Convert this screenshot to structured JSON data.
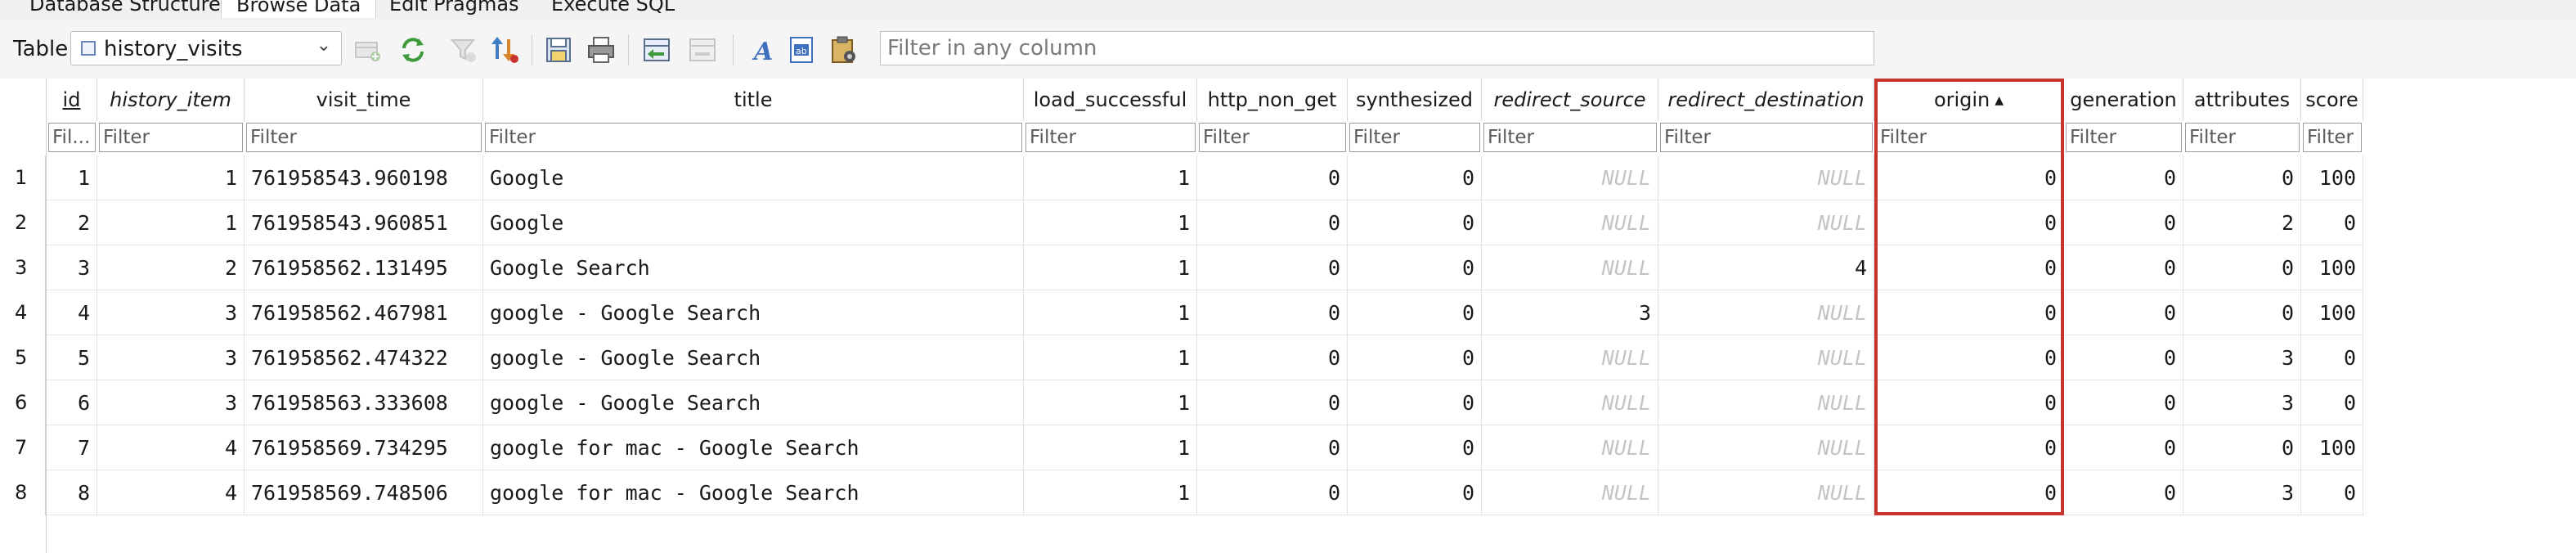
{
  "tabs": [
    {
      "label": "Database Structure",
      "active": false
    },
    {
      "label": "Browse Data",
      "active": true
    },
    {
      "label": "Edit Pragmas",
      "active": false
    },
    {
      "label": "Execute SQL",
      "active": false
    }
  ],
  "toolbar": {
    "table_label": "Table:",
    "table_name": "history_visits",
    "filter_placeholder": "Filter in any column"
  },
  "columns": [
    {
      "key": "id",
      "label": "id",
      "italic": false,
      "underline": true,
      "sorted": false
    },
    {
      "key": "history_item",
      "label": "history_item",
      "italic": true,
      "underline": false,
      "sorted": false
    },
    {
      "key": "visit_time",
      "label": "visit_time",
      "italic": false,
      "underline": false,
      "sorted": false
    },
    {
      "key": "title",
      "label": "title",
      "italic": false,
      "underline": false,
      "sorted": false
    },
    {
      "key": "load_successful",
      "label": "load_successful",
      "italic": false,
      "underline": false,
      "sorted": false
    },
    {
      "key": "http_non_get",
      "label": "http_non_get",
      "italic": false,
      "underline": false,
      "sorted": false
    },
    {
      "key": "synthesized",
      "label": "synthesized",
      "italic": false,
      "underline": false,
      "sorted": false
    },
    {
      "key": "redirect_source",
      "label": "redirect_source",
      "italic": true,
      "underline": false,
      "sorted": false
    },
    {
      "key": "redirect_destination",
      "label": "redirect_destination",
      "italic": true,
      "underline": false,
      "sorted": false
    },
    {
      "key": "origin",
      "label": "origin",
      "italic": false,
      "underline": false,
      "sorted": true,
      "sort_indicator": "▲"
    },
    {
      "key": "generation",
      "label": "generation",
      "italic": false,
      "underline": false,
      "sorted": false
    },
    {
      "key": "attributes",
      "label": "attributes",
      "italic": false,
      "underline": false,
      "sorted": false
    },
    {
      "key": "score",
      "label": "score",
      "italic": false,
      "underline": false,
      "sorted": false
    }
  ],
  "filter_placeholders": [
    "Fil...",
    "Filter",
    "Filter",
    "Filter",
    "Filter",
    "Filter",
    "Filter",
    "Filter",
    "Filter",
    "Filter",
    "Filter",
    "Filter",
    "Filter"
  ],
  "rows": [
    {
      "rownum": "1",
      "cells": [
        "1",
        "1",
        "761958543.960198",
        "Google",
        "1",
        "0",
        "0",
        "NULL",
        "NULL",
        "0",
        "0",
        "0",
        "100"
      ]
    },
    {
      "rownum": "2",
      "cells": [
        "2",
        "1",
        "761958543.960851",
        "Google",
        "1",
        "0",
        "0",
        "NULL",
        "NULL",
        "0",
        "0",
        "2",
        "0"
      ]
    },
    {
      "rownum": "3",
      "cells": [
        "3",
        "2",
        "761958562.131495",
        "Google Search",
        "1",
        "0",
        "0",
        "NULL",
        "4",
        "0",
        "0",
        "0",
        "100"
      ]
    },
    {
      "rownum": "4",
      "cells": [
        "4",
        "3",
        "761958562.467981",
        "google - Google Search",
        "1",
        "0",
        "0",
        "3",
        "NULL",
        "0",
        "0",
        "0",
        "100"
      ]
    },
    {
      "rownum": "5",
      "cells": [
        "5",
        "3",
        "761958562.474322",
        "google - Google Search",
        "1",
        "0",
        "0",
        "NULL",
        "NULL",
        "0",
        "0",
        "3",
        "0"
      ]
    },
    {
      "rownum": "6",
      "cells": [
        "6",
        "3",
        "761958563.333608",
        "google - Google Search",
        "1",
        "0",
        "0",
        "NULL",
        "NULL",
        "0",
        "0",
        "3",
        "0"
      ]
    },
    {
      "rownum": "7",
      "cells": [
        "7",
        "4",
        "761958569.734295",
        "google for mac - Google Search",
        "1",
        "0",
        "0",
        "NULL",
        "NULL",
        "0",
        "0",
        "0",
        "100"
      ]
    },
    {
      "rownum": "8",
      "cells": [
        "8",
        "4",
        "761958569.748506",
        "google for mac - Google Search",
        "1",
        "0",
        "0",
        "NULL",
        "NULL",
        "0",
        "0",
        "3",
        "0"
      ]
    }
  ],
  "highlight": {
    "column": "origin",
    "color": "#c8342d"
  },
  "icons": [
    "table-icon",
    "new-record-icon",
    "refresh-icon",
    "clear-filters-icon",
    "sort-icon",
    "save-table-icon",
    "print-icon",
    "insert-values-icon",
    "delete-record-icon",
    "text-format-icon",
    "edit-cell-icon",
    "clipboard-icon"
  ]
}
